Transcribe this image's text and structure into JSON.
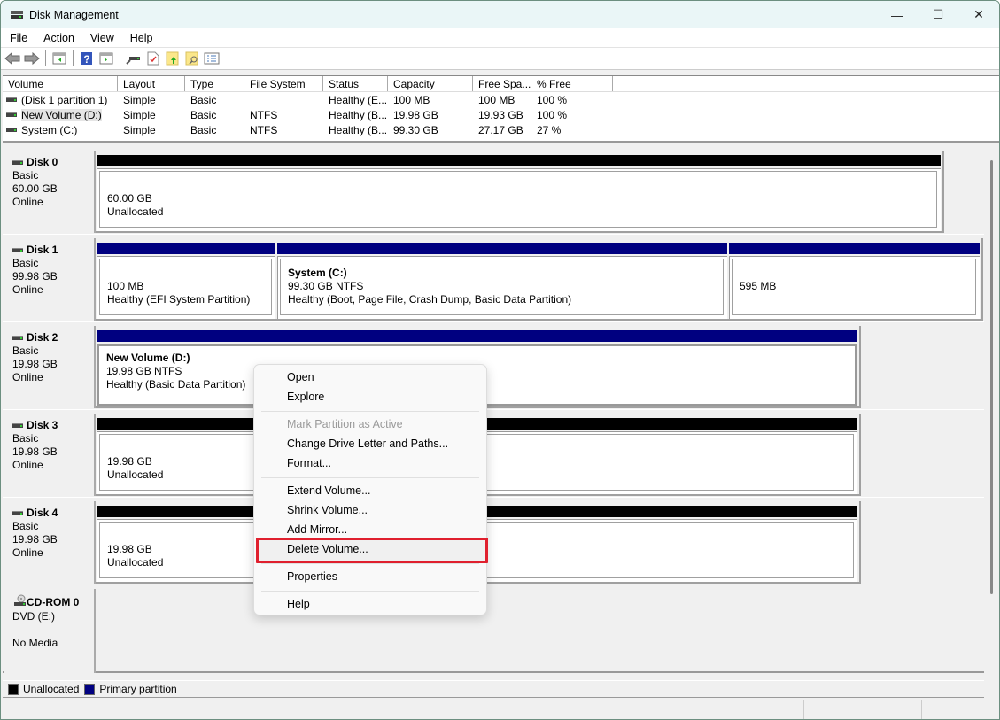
{
  "window": {
    "title": "Disk Management",
    "minimize": "—",
    "maximize": "☐",
    "close": "✕"
  },
  "menu": [
    "File",
    "Action",
    "View",
    "Help"
  ],
  "toolbar": {
    "icons": [
      "back-arrow-icon",
      "forward-arrow-icon",
      "show-hide-console-tree-icon",
      "help-icon",
      "action-pane-icon",
      "connect-drive-icon",
      "properties-check-icon",
      "folder-up-icon",
      "folder-search-icon",
      "list-settings-icon"
    ]
  },
  "volumes": {
    "columns": [
      "Volume",
      "Layout",
      "Type",
      "File System",
      "Status",
      "Capacity",
      "Free Spa...",
      "% Free"
    ],
    "rows": [
      [
        "(Disk 1 partition 1)",
        "Simple",
        "Basic",
        "",
        "Healthy (E...",
        "100 MB",
        "100 MB",
        "100 %"
      ],
      [
        "New Volume (D:)",
        "Simple",
        "Basic",
        "NTFS",
        "Healthy (B...",
        "19.98 GB",
        "19.93 GB",
        "100 %"
      ],
      [
        "System (C:)",
        "Simple",
        "Basic",
        "NTFS",
        "Healthy (B...",
        "99.30 GB",
        "27.17 GB",
        "27 %"
      ]
    ]
  },
  "disks": [
    {
      "name": "Disk 0",
      "type": "Basic",
      "size": "60.00 GB",
      "state": "Online",
      "partitions": [
        {
          "title": "",
          "line1": "60.00 GB",
          "line2": "Unallocated",
          "kind": "unallocated"
        }
      ]
    },
    {
      "name": "Disk 1",
      "type": "Basic",
      "size": "99.98 GB",
      "state": "Online",
      "partitions": [
        {
          "title": "",
          "line1": "100 MB",
          "line2": "Healthy (EFI System Partition)",
          "kind": "primary"
        },
        {
          "title": "System  (C:)",
          "line1": "99.30 GB NTFS",
          "line2": "Healthy (Boot, Page File, Crash Dump, Basic Data Partition)",
          "kind": "primary"
        },
        {
          "title": "",
          "line1": "595 MB",
          "line2": "",
          "kind": "primary"
        }
      ]
    },
    {
      "name": "Disk 2",
      "type": "Basic",
      "size": "19.98 GB",
      "state": "Online",
      "partitions": [
        {
          "title": "New Volume  (D:)",
          "line1": "19.98 GB NTFS",
          "line2": "Healthy (Basic Data Partition)",
          "kind": "primary",
          "selected": true
        }
      ]
    },
    {
      "name": "Disk 3",
      "type": "Basic",
      "size": "19.98 GB",
      "state": "Online",
      "partitions": [
        {
          "title": "",
          "line1": "19.98 GB",
          "line2": "Unallocated",
          "kind": "unallocated"
        }
      ]
    },
    {
      "name": "Disk 4",
      "type": "Basic",
      "size": "19.98 GB",
      "state": "Online",
      "partitions": [
        {
          "title": "",
          "line1": "19.98 GB",
          "line2": "Unallocated",
          "kind": "unallocated"
        }
      ]
    }
  ],
  "cdrom": {
    "name": "CD-ROM 0",
    "drive": "DVD (E:)",
    "state": "No Media"
  },
  "legend": [
    {
      "label": "Unallocated",
      "color": "#000000"
    },
    {
      "label": "Primary partition",
      "color": "#000080"
    }
  ],
  "context_menu": {
    "items": [
      {
        "label": "Open",
        "enabled": true
      },
      {
        "label": "Explore",
        "enabled": true
      },
      {
        "label": "Mark Partition as Active",
        "enabled": false
      },
      {
        "label": "Change Drive Letter and Paths...",
        "enabled": true
      },
      {
        "label": "Format...",
        "enabled": true
      },
      {
        "label": "Extend Volume...",
        "enabled": true
      },
      {
        "label": "Shrink Volume...",
        "enabled": true
      },
      {
        "label": "Add Mirror...",
        "enabled": true
      },
      {
        "label": "Delete Volume...",
        "enabled": true,
        "highlighted": true
      },
      {
        "label": "Properties",
        "enabled": true
      },
      {
        "label": "Help",
        "enabled": true
      }
    ]
  },
  "colors": {
    "unallocated": "#000000",
    "primary": "#000080",
    "highlight": "#e0202e"
  }
}
